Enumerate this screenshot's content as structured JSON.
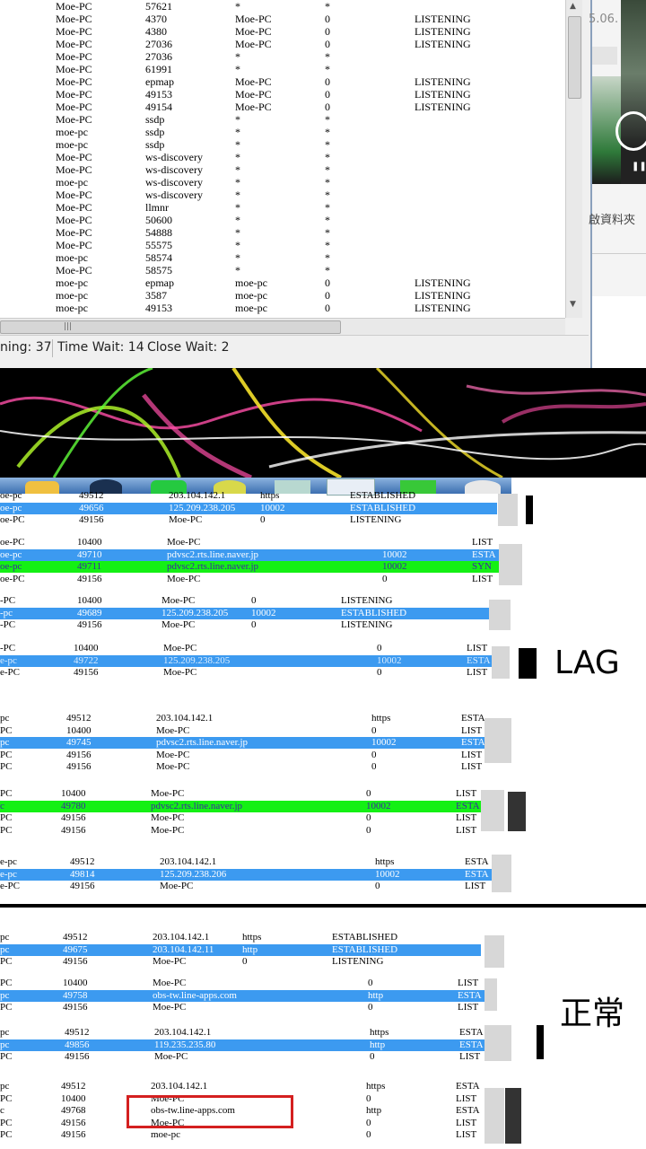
{
  "top_window": {
    "rows": [
      [
        "Moe-PC",
        "57621",
        "*",
        "*",
        ""
      ],
      [
        "Moe-PC",
        "4370",
        "Moe-PC",
        "0",
        "LISTENING"
      ],
      [
        "Moe-PC",
        "4380",
        "Moe-PC",
        "0",
        "LISTENING"
      ],
      [
        "Moe-PC",
        "27036",
        "Moe-PC",
        "0",
        "LISTENING"
      ],
      [
        "Moe-PC",
        "27036",
        "*",
        "*",
        ""
      ],
      [
        "Moe-PC",
        "61991",
        "*",
        "*",
        ""
      ],
      [
        "Moe-PC",
        "epmap",
        "Moe-PC",
        "0",
        "LISTENING"
      ],
      [
        "Moe-PC",
        "49153",
        "Moe-PC",
        "0",
        "LISTENING"
      ],
      [
        "Moe-PC",
        "49154",
        "Moe-PC",
        "0",
        "LISTENING"
      ],
      [
        "Moe-PC",
        "ssdp",
        "*",
        "*",
        ""
      ],
      [
        "moe-pc",
        "ssdp",
        "*",
        "*",
        ""
      ],
      [
        "moe-pc",
        "ssdp",
        "*",
        "*",
        ""
      ],
      [
        "Moe-PC",
        "ws-discovery",
        "*",
        "*",
        ""
      ],
      [
        "Moe-PC",
        "ws-discovery",
        "*",
        "*",
        ""
      ],
      [
        "moe-pc",
        "ws-discovery",
        "*",
        "*",
        ""
      ],
      [
        "Moe-PC",
        "ws-discovery",
        "*",
        "*",
        ""
      ],
      [
        "Moe-PC",
        "llmnr",
        "*",
        "*",
        ""
      ],
      [
        "Moe-PC",
        "50600",
        "*",
        "*",
        ""
      ],
      [
        "Moe-PC",
        "54888",
        "*",
        "*",
        ""
      ],
      [
        "Moe-PC",
        "55575",
        "*",
        "*",
        ""
      ],
      [
        "moe-pc",
        "58574",
        "*",
        "*",
        ""
      ],
      [
        "Moe-PC",
        "58575",
        "*",
        "*",
        ""
      ],
      [
        "moe-pc",
        "epmap",
        "moe-pc",
        "0",
        "LISTENING"
      ],
      [
        "moe-pc",
        "3587",
        "moe-pc",
        "0",
        "LISTENING"
      ],
      [
        "moe-pc",
        "49153",
        "moe-pc",
        "0",
        "LISTENING"
      ]
    ],
    "status": {
      "listening": "ning: 37",
      "time_wait": "Time Wait: 14",
      "close_wait": "Close Wait: 2"
    }
  },
  "right_app": {
    "date_fragment": "5.06.",
    "folder_text": "啟資料夾"
  },
  "strips": [
    {
      "id": "s1",
      "rows": [
        {
          "style": "plain",
          "cells": [
            "oe-pc",
            "49512",
            "203.104.142.1",
            "https",
            "ESTABLISHED"
          ]
        },
        {
          "style": "blue",
          "cells": [
            "oe-pc",
            "49656",
            "125.209.238.205",
            "10002",
            "ESTABLISHED"
          ]
        },
        {
          "style": "plain",
          "cells": [
            "oe-PC",
            "49156",
            "Moe-PC",
            "0",
            "LISTENING"
          ]
        }
      ]
    },
    {
      "id": "s2",
      "rows": [
        {
          "style": "plain",
          "cells": [
            "oe-PC",
            "10400",
            "Moe-PC",
            "",
            "LIST"
          ]
        },
        {
          "style": "blue",
          "cells": [
            "oe-pc",
            "49710",
            "pdvsc2.rts.line.naver.jp",
            "10002",
            "ESTA"
          ]
        },
        {
          "style": "green",
          "cells": [
            "oe-pc",
            "49711",
            "pdvsc2.rts.line.naver.jp",
            "10002",
            "SYN"
          ]
        },
        {
          "style": "plain",
          "cells": [
            "oe-PC",
            "49156",
            "Moe-PC",
            "0",
            "LIST"
          ]
        }
      ]
    },
    {
      "id": "s3",
      "rows": [
        {
          "style": "plain",
          "cells": [
            "-PC",
            "10400",
            "Moe-PC",
            "0",
            "LISTENING"
          ]
        },
        {
          "style": "blue",
          "cells": [
            "-pc",
            "49689",
            "125.209.238.205",
            "10002",
            "ESTABLISHED"
          ]
        },
        {
          "style": "plain",
          "cells": [
            "-PC",
            "49156",
            "Moe-PC",
            "0",
            "LISTENING"
          ]
        }
      ]
    },
    {
      "id": "s4",
      "rows": [
        {
          "style": "plain",
          "cells": [
            "-PC",
            "10400",
            "Moe-PC",
            "0",
            "LIST"
          ]
        },
        {
          "style": "blue2",
          "cells": [
            "e-pc",
            "49722",
            "125.209.238.205",
            "10002",
            "ESTA"
          ]
        },
        {
          "style": "plain",
          "cells": [
            "e-PC",
            "49156",
            "Moe-PC",
            "0",
            "LIST"
          ]
        }
      ]
    },
    {
      "id": "s5",
      "rows": [
        {
          "style": "plain",
          "cells": [
            "pc",
            "49512",
            "203.104.142.1",
            "https",
            "ESTA"
          ]
        },
        {
          "style": "plain",
          "cells": [
            "PC",
            "10400",
            "Moe-PC",
            "0",
            "LIST"
          ]
        },
        {
          "style": "blue",
          "cells": [
            "pc",
            "49745",
            "pdvsc2.rts.line.naver.jp",
            "10002",
            "ESTA"
          ]
        },
        {
          "style": "plain",
          "cells": [
            "PC",
            "49156",
            "Moe-PC",
            "0",
            "LIST"
          ]
        },
        {
          "style": "plain",
          "cells": [
            "PC",
            "49156",
            "Moe-PC",
            "0",
            "LIST"
          ]
        }
      ]
    },
    {
      "id": "s6",
      "rows": [
        {
          "style": "plain",
          "cells": [
            "PC",
            "10400",
            "Moe-PC",
            "0",
            "LIST"
          ]
        },
        {
          "style": "green",
          "cells": [
            "c",
            "49780",
            "pdvsc2.rts.line.naver.jp",
            "10002",
            "ESTA"
          ]
        },
        {
          "style": "plain",
          "cells": [
            "PC",
            "49156",
            "Moe-PC",
            "0",
            "LIST"
          ]
        },
        {
          "style": "plain",
          "cells": [
            "PC",
            "49156",
            "Moe-PC",
            "0",
            "LIST"
          ]
        }
      ]
    },
    {
      "id": "s7",
      "rows": [
        {
          "style": "plain",
          "cells": [
            "e-pc",
            "49512",
            "203.104.142.1",
            "https",
            "ESTA"
          ]
        },
        {
          "style": "blue",
          "cells": [
            "e-pc",
            "49814",
            "125.209.238.206",
            "10002",
            "ESTA"
          ]
        },
        {
          "style": "plain",
          "cells": [
            "e-PC",
            "49156",
            "Moe-PC",
            "0",
            "LIST"
          ]
        }
      ]
    },
    {
      "id": "s8",
      "rows": [
        {
          "style": "plain",
          "cells": [
            "pc",
            "49512",
            "203.104.142.1",
            "https",
            "ESTABLISHED"
          ]
        },
        {
          "style": "blue",
          "cells": [
            "pc",
            "49675",
            "203.104.142.11",
            "http",
            "ESTABLISHED"
          ]
        },
        {
          "style": "plain",
          "cells": [
            "PC",
            "49156",
            "Moe-PC",
            "0",
            "LISTENING"
          ]
        }
      ]
    },
    {
      "id": "s9",
      "rows": [
        {
          "style": "plain",
          "cells": [
            "PC",
            "10400",
            "Moe-PC",
            "0",
            "LIST"
          ]
        },
        {
          "style": "blue",
          "cells": [
            "pc",
            "49758",
            "obs-tw.line-apps.com",
            "http",
            "ESTA"
          ]
        },
        {
          "style": "plain",
          "cells": [
            "PC",
            "49156",
            "Moe-PC",
            "0",
            "LIST"
          ]
        }
      ]
    },
    {
      "id": "s10",
      "rows": [
        {
          "style": "plain",
          "cells": [
            "pc",
            "49512",
            "203.104.142.1",
            "https",
            "ESTA"
          ]
        },
        {
          "style": "blue",
          "cells": [
            "pc",
            "49856",
            "119.235.235.80",
            "http",
            "ESTA"
          ]
        },
        {
          "style": "plain",
          "cells": [
            "PC",
            "49156",
            "Moe-PC",
            "0",
            "LIST"
          ]
        }
      ]
    },
    {
      "id": "s11",
      "rows": [
        {
          "style": "plain",
          "cells": [
            "pc",
            "49512",
            "203.104.142.1",
            "https",
            "ESTA"
          ]
        },
        {
          "style": "plain",
          "cells": [
            "PC",
            "10400",
            "Moe-PC",
            "0",
            "LIST"
          ]
        },
        {
          "style": "plain",
          "cells": [
            "c",
            "49768",
            "obs-tw.line-apps.com",
            "http",
            "ESTA"
          ]
        },
        {
          "style": "plain",
          "cells": [
            "PC",
            "49156",
            "Moe-PC",
            "0",
            "LIST"
          ]
        },
        {
          "style": "plain",
          "cells": [
            "PC",
            "49156",
            "moe-pc",
            "0",
            "LIST"
          ]
        }
      ]
    }
  ],
  "labels": {
    "lag": "LAG",
    "normal": "正常"
  },
  "colors": {
    "highlight_blue": "#3c9af0",
    "highlight_green": "#14f014",
    "annotation_red": "#d42020"
  }
}
